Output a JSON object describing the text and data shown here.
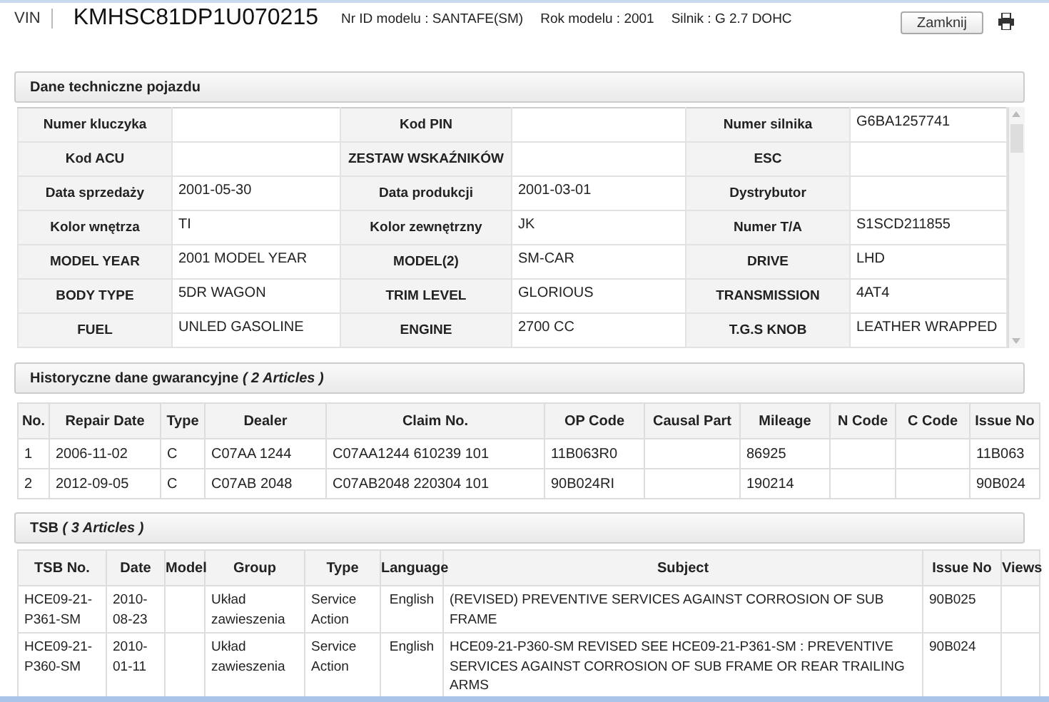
{
  "header": {
    "vin_label": "VIN",
    "vin": "KMHSC81DP1U070215",
    "model_id": "Nr ID modelu : SANTAFE(SM)",
    "model_year": "Rok modelu : 2001",
    "engine": "Silnik : G 2.7 DOHC",
    "close_button": "Zamknij"
  },
  "tech": {
    "title": "Dane techniczne pojazdu",
    "rows": [
      [
        {
          "label": "Numer kluczyka"
        },
        {
          "label": "Kod PIN"
        },
        {
          "label": "Numer silnika",
          "value": "G6BA1257741"
        }
      ],
      [
        {
          "label": "Kod ACU"
        },
        {
          "label": "ZESTAW WSKAŹNIKÓW"
        },
        {
          "label": "ESC"
        }
      ],
      [
        {
          "label": "Data sprzedaży",
          "value": "2001-05-30"
        },
        {
          "label": "Data produkcji",
          "value": "2001-03-01"
        },
        {
          "label": "Dystrybutor"
        }
      ],
      [
        {
          "label": "Kolor wnętrza",
          "value": "TI"
        },
        {
          "label": "Kolor zewnętrzny",
          "value": "JK"
        },
        {
          "label": "Numer T/A",
          "value": "S1SCD211855"
        }
      ],
      [
        {
          "label": "MODEL YEAR",
          "value": "2001 MODEL YEAR"
        },
        {
          "label": "MODEL(2)",
          "value": "SM-CAR"
        },
        {
          "label": "DRIVE",
          "value": "LHD"
        }
      ],
      [
        {
          "label": "BODY TYPE",
          "value": "5DR WAGON"
        },
        {
          "label": "TRIM LEVEL",
          "value": "GLORIOUS"
        },
        {
          "label": "TRANSMISSION",
          "value": "4AT4"
        }
      ],
      [
        {
          "label": "FUEL",
          "value": "UNLED GASOLINE"
        },
        {
          "label": "ENGINE",
          "value": "2700 CC"
        },
        {
          "label": "T.G.S KNOB",
          "value": "LEATHER WRAPPED"
        }
      ]
    ]
  },
  "warranty": {
    "title": "Historyczne dane gwarancyjne *( 2 Articles )*",
    "columns": [
      "No.",
      "Repair Date",
      "Type",
      "Dealer",
      "Claim No.",
      "OP Code",
      "Causal Part",
      "Mileage",
      "N Code",
      "C Code",
      "Issue No"
    ],
    "rows": [
      [
        "1",
        "2006-11-02",
        "C",
        "C07AA 1244",
        "C07AA1244 610239 101",
        "11B063R0",
        null,
        "86925",
        null,
        null,
        "11B063"
      ],
      [
        "2",
        "2012-09-05",
        "C",
        "C07AB 2048",
        "C07AB2048 220304 101",
        "90B024RI",
        null,
        "190214",
        null,
        null,
        "90B024"
      ]
    ]
  },
  "tsb": {
    "title": "TSB *( 3 Articles )*",
    "columns": [
      "TSB No.",
      "Date",
      "Model",
      "Group",
      "Type",
      "Language",
      "Subject",
      "Issue No",
      "Views"
    ],
    "rows": [
      [
        "HCE09-21-P361-SM",
        "2010-08-23",
        null,
        "Układ zawieszenia",
        "Service Action",
        "English",
        "(REVISED) PREVENTIVE SERVICES AGAINST CORROSION OF SUB FRAME",
        "90B025",
        null
      ],
      [
        "HCE09-21-P360-SM",
        "2010-01-11",
        null,
        "Układ zawieszenia",
        "Service Action",
        "English",
        "HCE09-21-P360-SM REVISED SEE HCE09-21-P361-SM : PREVENTIVE SERVICES AGAINST CORROSION OF SUB FRAME OR REAR TRAILING ARMS",
        "90B024",
        null
      ]
    ]
  }
}
